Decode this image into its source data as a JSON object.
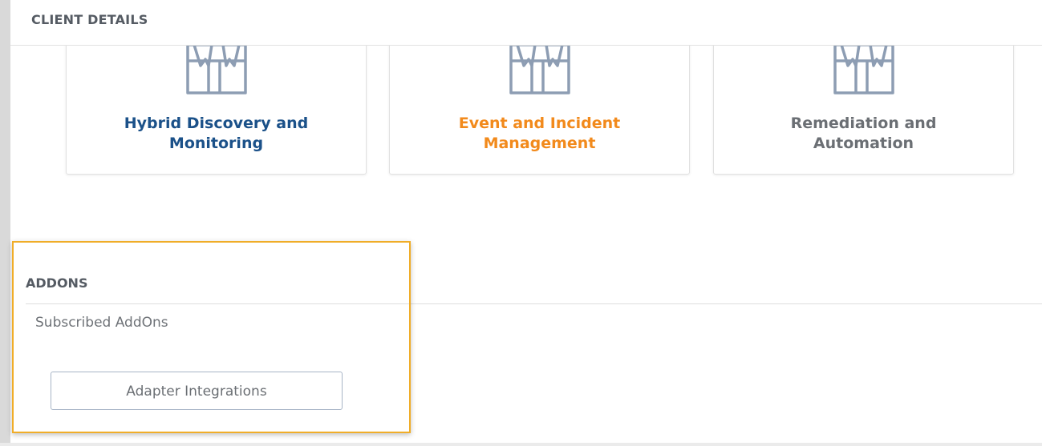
{
  "client_details": {
    "title": "CLIENT DETAILS"
  },
  "services": [
    {
      "label": "Hybrid Discovery and Monitoring",
      "line1": "Hybrid Discovery and",
      "line2": "Monitoring",
      "color": "#1b5189",
      "icon": "gift-box-icon"
    },
    {
      "label": "Event and Incident Management",
      "line1": "Event and Incident",
      "line2": "Management",
      "color": "#f28a1c",
      "icon": "gift-box-icon"
    },
    {
      "label": "Remediation and Automation",
      "line1": "Remediation and",
      "line2": "Automation",
      "color": "#6b6f74",
      "icon": "gift-box-icon"
    }
  ],
  "addons": {
    "title": "ADDONS",
    "subscribed_label": "Subscribed AddOns",
    "items": [
      {
        "label": "Adapter Integrations"
      }
    ],
    "highlight_color": "#f0ad28"
  }
}
